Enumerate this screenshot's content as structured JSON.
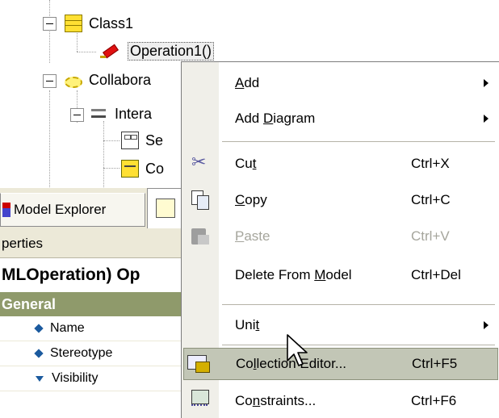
{
  "tree": {
    "items": [
      {
        "label": "Class1",
        "icon": "class-icon"
      },
      {
        "label": "Operation1()",
        "icon": "operation-icon"
      },
      {
        "label": "Collabora",
        "icon": "collaboration-icon"
      },
      {
        "label": "Intera",
        "icon": "interaction-icon"
      },
      {
        "label": "Se",
        "icon": "sequence-diagram-icon"
      },
      {
        "label": "Co",
        "icon": "collaboration-diagram-icon"
      }
    ]
  },
  "tabs": {
    "model_explorer": "Model Explorer"
  },
  "properties": {
    "header": "perties",
    "subject": "MLOperation) Op",
    "group": "General",
    "rows": [
      {
        "label": "Name",
        "marker": "diamond"
      },
      {
        "label": "Stereotype",
        "marker": "diamond"
      },
      {
        "label": "Visibility",
        "marker": "triangle-down"
      }
    ]
  },
  "menu": {
    "items": [
      {
        "pre": "",
        "key": "A",
        "post": "dd",
        "shortcut": "",
        "submenu": true,
        "disabled": false,
        "highlight": false
      },
      {
        "pre": "Add ",
        "key": "D",
        "post": "iagram",
        "shortcut": "",
        "submenu": true,
        "disabled": false,
        "highlight": false
      },
      {
        "pre": "Cu",
        "key": "t",
        "post": "",
        "shortcut": "Ctrl+X",
        "submenu": false,
        "disabled": false,
        "highlight": false,
        "icon": "scissors-icon"
      },
      {
        "pre": "",
        "key": "C",
        "post": "opy",
        "shortcut": "Ctrl+C",
        "submenu": false,
        "disabled": false,
        "highlight": false,
        "icon": "copy-icon"
      },
      {
        "pre": "",
        "key": "P",
        "post": "aste",
        "shortcut": "Ctrl+V",
        "submenu": false,
        "disabled": true,
        "highlight": false,
        "icon": "paste-icon"
      },
      {
        "pre": "Delete From ",
        "key": "M",
        "post": "odel",
        "shortcut": "Ctrl+Del",
        "submenu": false,
        "disabled": false,
        "highlight": false
      },
      {
        "pre": "Uni",
        "key": "t",
        "post": "",
        "shortcut": "",
        "submenu": true,
        "disabled": false,
        "highlight": false
      },
      {
        "pre": "Co",
        "key": "l",
        "post": "lection Editor...",
        "shortcut": "Ctrl+F5",
        "submenu": false,
        "disabled": false,
        "highlight": true,
        "icon": "collection-editor-icon"
      },
      {
        "pre": "Co",
        "key": "n",
        "post": "straints...",
        "shortcut": "Ctrl+F6",
        "submenu": false,
        "disabled": false,
        "highlight": false,
        "icon": "constraints-icon"
      }
    ]
  },
  "colors": {
    "menu_highlight": "#c2c6b6",
    "group_header": "#8f9a6b",
    "panel_bg": "#ece9d8"
  }
}
